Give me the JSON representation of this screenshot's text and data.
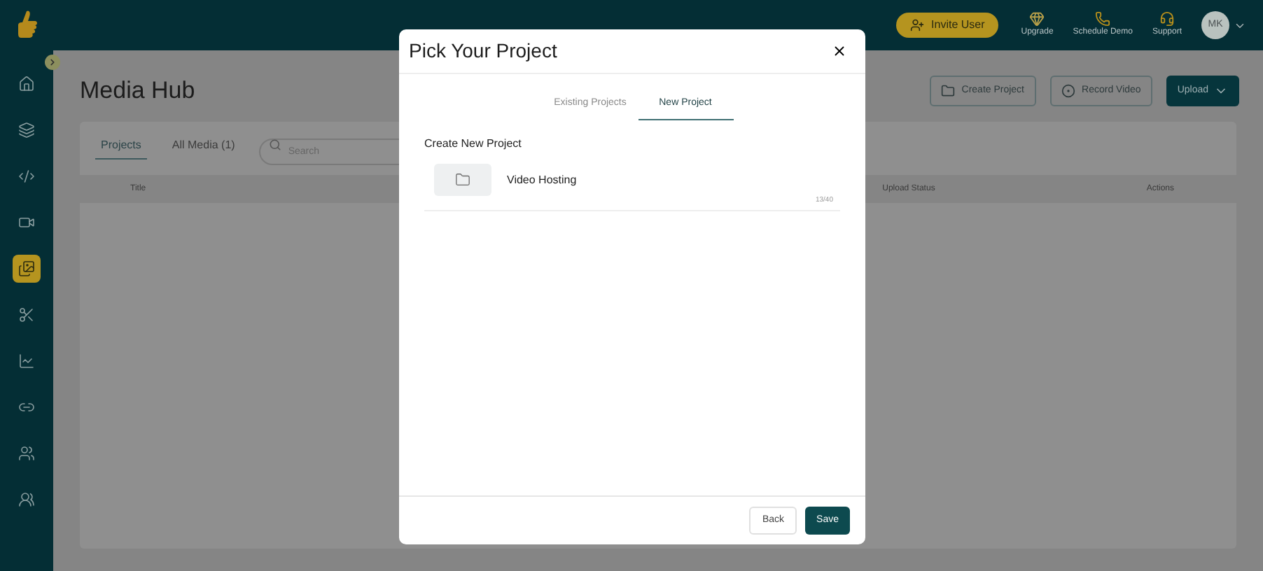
{
  "header": {
    "invite_button": "Invite User",
    "nav_items": [
      {
        "label": "Upgrade"
      },
      {
        "label": "Schedule Demo"
      },
      {
        "label": "Support"
      }
    ],
    "avatar": "MK"
  },
  "sidebar": {
    "items": [
      {
        "selected": false
      },
      {
        "selected": false
      },
      {
        "selected": false
      },
      {
        "selected": false
      },
      {
        "selected": true
      },
      {
        "selected": false
      },
      {
        "selected": false
      },
      {
        "selected": false
      },
      {
        "selected": false
      },
      {
        "selected": false
      }
    ]
  },
  "page": {
    "title": "Media Hub",
    "actions": [
      {
        "label": "Create Project",
        "kind": "outline"
      },
      {
        "label": "Record Video",
        "kind": "outline"
      },
      {
        "label": "Upload",
        "kind": "primary"
      }
    ],
    "tabs": [
      {
        "label": "Projects",
        "selected": true
      },
      {
        "label": "All Media (1)",
        "selected": false
      }
    ],
    "search": {
      "placeholder": "Search"
    },
    "table": {
      "columns": [
        "Title",
        "Upload Status",
        "Actions"
      ]
    }
  },
  "modal": {
    "title": "Pick Your Project",
    "tabs": [
      {
        "label": "Existing Projects",
        "selected": false
      },
      {
        "label": "New Project",
        "selected": true
      }
    ],
    "section_title": "Create New Project",
    "project_name": {
      "value": "Video Hosting",
      "counter": "13/40"
    },
    "buttons": [
      {
        "label": "Back",
        "kind": "secondary"
      },
      {
        "label": "Save",
        "kind": "primary"
      }
    ]
  }
}
